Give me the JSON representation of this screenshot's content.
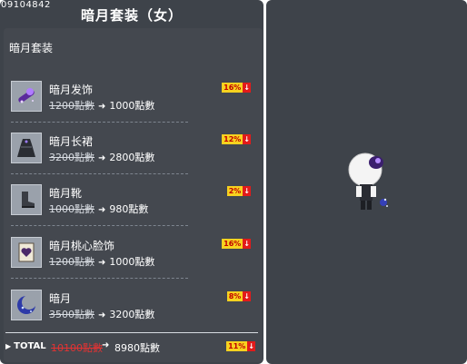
{
  "code": "09104842",
  "title": "暗月套装（女）",
  "subtitle": "暗月套装",
  "items": [
    {
      "name": "暗月发饰",
      "old_price": "1200點數",
      "new_price": "1000點數",
      "discount": "16%",
      "icon": "purple-hairpin-icon"
    },
    {
      "name": "暗月长裙",
      "old_price": "3200點數",
      "new_price": "2800點數",
      "discount": "12%",
      "icon": "dark-dress-icon"
    },
    {
      "name": "暗月靴",
      "old_price": "1000點數",
      "new_price": "980點數",
      "discount": "2%",
      "icon": "boot-icon"
    },
    {
      "name": "暗月桃心脸饰",
      "old_price": "1200點數",
      "new_price": "1000點數",
      "discount": "16%",
      "icon": "heart-face-accessory-icon"
    },
    {
      "name": "暗月",
      "old_price": "3500點數",
      "new_price": "3200點數",
      "discount": "8%",
      "icon": "crescent-moon-icon"
    }
  ],
  "total": {
    "label": "TOTAL",
    "old_price": "10100點數",
    "new_price": "8980點數",
    "discount": "11%"
  },
  "arrow_symbol": "➜",
  "down_symbol": "↓",
  "colors": {
    "panel": "#3e434a",
    "badge_yellow": "#f7d21f",
    "badge_red": "#e21b1b",
    "total_old": "#e23333"
  }
}
